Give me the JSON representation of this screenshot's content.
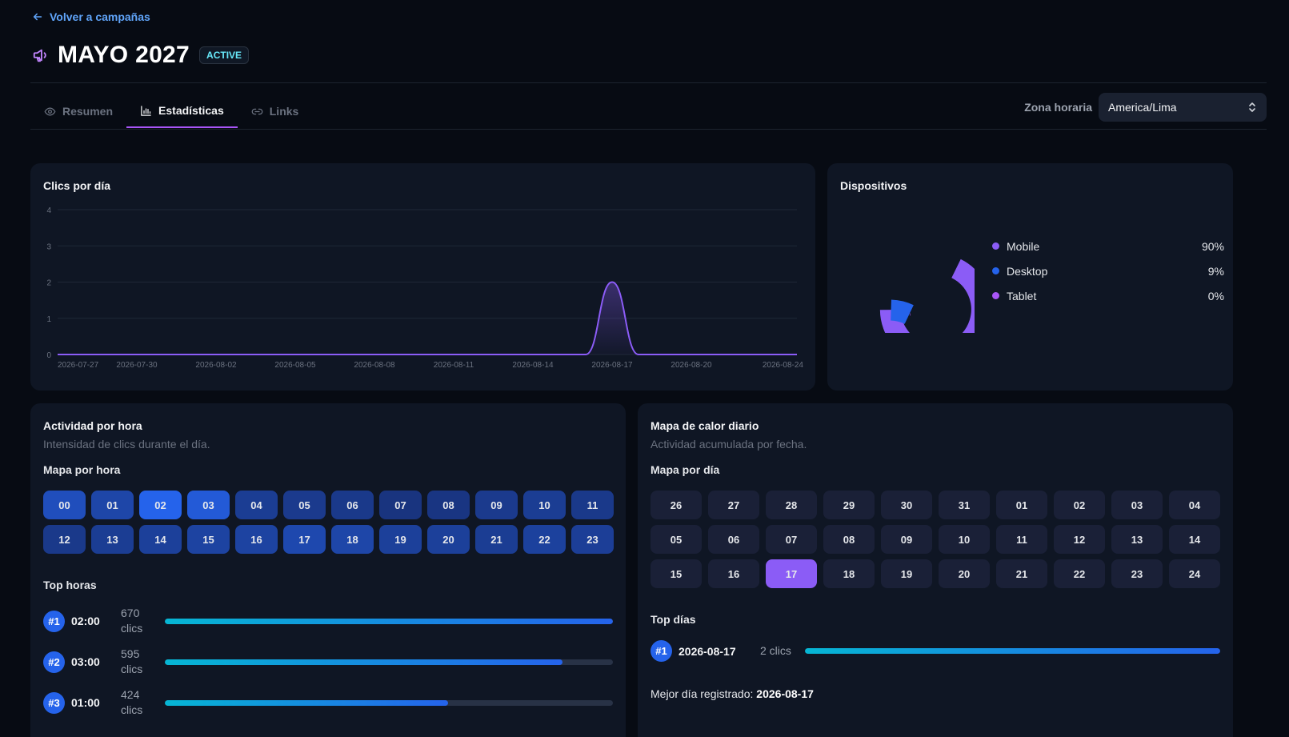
{
  "nav": {
    "back_label": "Volver a campañas"
  },
  "campaign": {
    "title": "MAYO 2027",
    "status": "ACTIVE"
  },
  "tabs": [
    {
      "label": "Resumen",
      "icon": "eye-icon",
      "active": false
    },
    {
      "label": "Estadísticas",
      "icon": "bar-chart-icon",
      "active": true
    },
    {
      "label": "Links",
      "icon": "link-icon",
      "active": false
    }
  ],
  "timezone": {
    "label": "Zona horaria",
    "value": "America/Lima"
  },
  "clicks_card": {
    "title": "Clics por día"
  },
  "devices_card": {
    "title": "Dispositivos",
    "items": [
      {
        "name": "Mobile",
        "pct": "90%",
        "color": "#8b5cf6"
      },
      {
        "name": "Desktop",
        "pct": "9%",
        "color": "#2563eb"
      },
      {
        "name": "Tablet",
        "pct": "0%",
        "color": "#a855f7"
      }
    ]
  },
  "chart_data": [
    {
      "type": "area",
      "title": "Clics por día",
      "xlabel": "",
      "ylabel": "",
      "ylim": [
        0,
        4
      ],
      "yticks": [
        "0",
        "1",
        "2",
        "3",
        "4"
      ],
      "xticks": [
        "2026-07-27",
        "2026-07-30",
        "2026-08-02",
        "2026-08-05",
        "2026-08-08",
        "2026-08-11",
        "2026-08-14",
        "2026-08-17",
        "2026-08-20",
        "2026-08-24"
      ],
      "grid": true,
      "color": "#8b5cf6",
      "x": [
        "2026-07-27",
        "2026-07-28",
        "2026-07-29",
        "2026-07-30",
        "2026-07-31",
        "2026-08-01",
        "2026-08-02",
        "2026-08-03",
        "2026-08-04",
        "2026-08-05",
        "2026-08-06",
        "2026-08-07",
        "2026-08-08",
        "2026-08-09",
        "2026-08-10",
        "2026-08-11",
        "2026-08-12",
        "2026-08-13",
        "2026-08-14",
        "2026-08-15",
        "2026-08-16",
        "2026-08-17",
        "2026-08-18",
        "2026-08-19",
        "2026-08-20",
        "2026-08-21",
        "2026-08-22",
        "2026-08-23",
        "2026-08-24"
      ],
      "values": [
        0,
        0,
        0,
        0,
        0,
        0,
        0,
        0,
        0,
        0,
        0,
        0,
        0,
        0,
        0,
        0,
        0,
        0,
        0,
        0,
        0,
        2,
        0,
        0,
        0,
        0,
        0,
        0,
        0
      ]
    },
    {
      "type": "pie",
      "title": "Dispositivos",
      "categories": [
        "Mobile",
        "Desktop",
        "Tablet"
      ],
      "values": [
        90,
        9,
        0.5
      ],
      "colors": [
        "#8b5cf6",
        "#2563eb",
        "#a855f7"
      ],
      "gap_deg": 90
    }
  ],
  "hourly_card": {
    "title": "Actividad por hora",
    "subtitle": "Intensidad de clics durante el día.",
    "map_label": "Mapa por hora",
    "hours": [
      {
        "label": "00",
        "level": 0.65
      },
      {
        "label": "01",
        "level": 0.5
      },
      {
        "label": "02",
        "level": 1.0
      },
      {
        "label": "03",
        "level": 0.85
      },
      {
        "label": "04",
        "level": 0.35
      },
      {
        "label": "05",
        "level": 0.3
      },
      {
        "label": "06",
        "level": 0.28
      },
      {
        "label": "07",
        "level": 0.2
      },
      {
        "label": "08",
        "level": 0.22
      },
      {
        "label": "09",
        "level": 0.3
      },
      {
        "label": "10",
        "level": 0.35
      },
      {
        "label": "11",
        "level": 0.28
      },
      {
        "label": "12",
        "level": 0.28
      },
      {
        "label": "13",
        "level": 0.35
      },
      {
        "label": "14",
        "level": 0.4
      },
      {
        "label": "15",
        "level": 0.45
      },
      {
        "label": "16",
        "level": 0.45
      },
      {
        "label": "17",
        "level": 0.55
      },
      {
        "label": "18",
        "level": 0.5
      },
      {
        "label": "19",
        "level": 0.4
      },
      {
        "label": "20",
        "level": 0.4
      },
      {
        "label": "21",
        "level": 0.35
      },
      {
        "label": "22",
        "level": 0.42
      },
      {
        "label": "23",
        "level": 0.38
      }
    ],
    "top_label": "Top horas",
    "top": [
      {
        "rank": "#1",
        "hour": "02:00",
        "count": "670",
        "unit": "clics",
        "fraction": 1.0
      },
      {
        "rank": "#2",
        "hour": "03:00",
        "count": "595",
        "unit": "clics",
        "fraction": 0.888
      },
      {
        "rank": "#3",
        "hour": "01:00",
        "count": "424",
        "unit": "clics",
        "fraction": 0.633
      }
    ]
  },
  "daily_card": {
    "title": "Mapa de calor diario",
    "subtitle": "Actividad acumulada por fecha.",
    "map_label": "Mapa por día",
    "days": [
      {
        "label": "26",
        "active": false
      },
      {
        "label": "27",
        "active": false
      },
      {
        "label": "28",
        "active": false
      },
      {
        "label": "29",
        "active": false
      },
      {
        "label": "30",
        "active": false
      },
      {
        "label": "31",
        "active": false
      },
      {
        "label": "01",
        "active": false
      },
      {
        "label": "02",
        "active": false
      },
      {
        "label": "03",
        "active": false
      },
      {
        "label": "04",
        "active": false
      },
      {
        "label": "05",
        "active": false
      },
      {
        "label": "06",
        "active": false
      },
      {
        "label": "07",
        "active": false
      },
      {
        "label": "08",
        "active": false
      },
      {
        "label": "09",
        "active": false
      },
      {
        "label": "10",
        "active": false
      },
      {
        "label": "11",
        "active": false
      },
      {
        "label": "12",
        "active": false
      },
      {
        "label": "13",
        "active": false
      },
      {
        "label": "14",
        "active": false
      },
      {
        "label": "15",
        "active": false
      },
      {
        "label": "16",
        "active": false
      },
      {
        "label": "17",
        "active": true
      },
      {
        "label": "18",
        "active": false
      },
      {
        "label": "19",
        "active": false
      },
      {
        "label": "20",
        "active": false
      },
      {
        "label": "21",
        "active": false
      },
      {
        "label": "22",
        "active": false
      },
      {
        "label": "23",
        "active": false
      },
      {
        "label": "24",
        "active": false
      }
    ],
    "top_label": "Top días",
    "top": [
      {
        "rank": "#1",
        "day": "2026-08-17",
        "count": "2 clics",
        "fraction": 1.0
      }
    ],
    "best_prefix": "Mejor día registrado:",
    "best_value": "2026-08-17"
  }
}
